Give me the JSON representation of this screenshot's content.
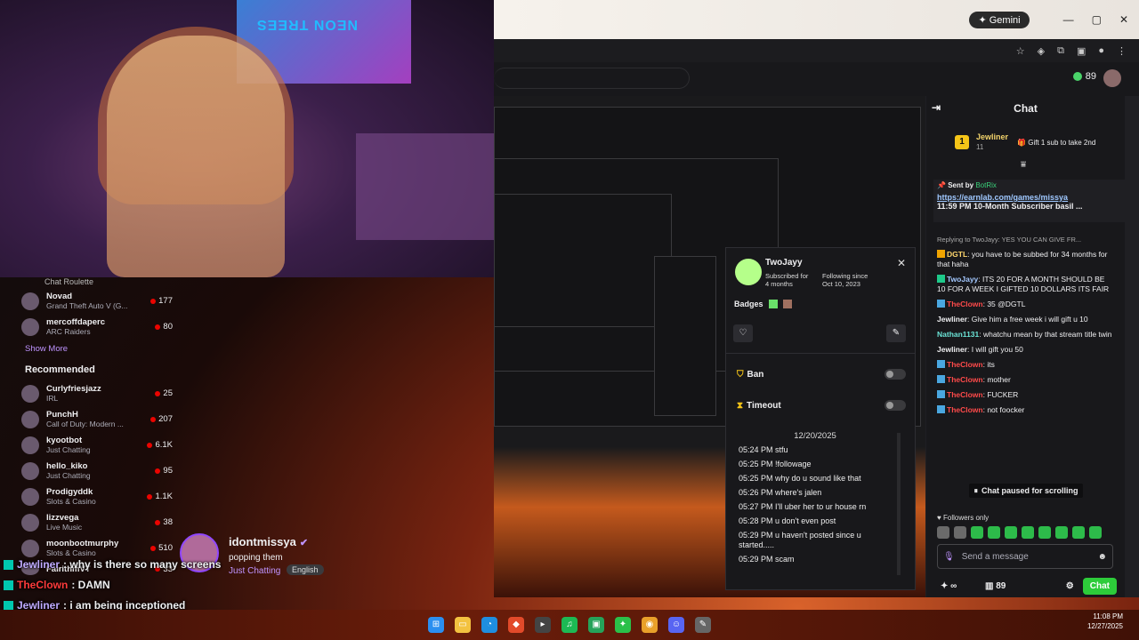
{
  "browser": {
    "gemini_label": "Gemini",
    "points": "89"
  },
  "sidebar": {
    "head": "Chat Roulette",
    "following": [
      {
        "name": "Novad",
        "game": "Grand Theft Auto V (G...",
        "viewers": "177"
      },
      {
        "name": "mercoffdaperc",
        "game": "ARC Raiders",
        "viewers": "80"
      }
    ],
    "show_more": "Show More",
    "recommended_title": "Recommended",
    "recommended": [
      {
        "name": "Curlyfriesjazz",
        "game": "IRL",
        "viewers": "25"
      },
      {
        "name": "PunchH",
        "game": "Call of Duty: Modern ...",
        "viewers": "207"
      },
      {
        "name": "kyootbot",
        "game": "Just Chatting",
        "viewers": "6.1K"
      },
      {
        "name": "hello_kiko",
        "game": "Just Chatting",
        "viewers": "95"
      },
      {
        "name": "Prodigyddk",
        "game": "Slots & Casino",
        "viewers": "1.1K"
      },
      {
        "name": "lizzvega",
        "game": "Live Music",
        "viewers": "38"
      },
      {
        "name": "moonbootmurphy",
        "game": "Slots & Casino",
        "viewers": "510"
      },
      {
        "name": "FairithmVT",
        "game": "",
        "viewers": "33"
      }
    ]
  },
  "channel": {
    "name": "idontmissya",
    "title": "popping them",
    "category": "Just Chatting",
    "language": "English"
  },
  "overlay_chat": [
    {
      "user": "Jewliner",
      "text": ": why is there so many screens",
      "color": "a"
    },
    {
      "user": "TheClown",
      "text": ": DAMN",
      "color": "b"
    },
    {
      "user": "Jewliner",
      "text": ": i am being inceptioned",
      "color": "a"
    }
  ],
  "usercard": {
    "name": "TwoJayy",
    "sub_label": "Subscribed for",
    "sub_value": "4 months",
    "follow_label": "Following since",
    "follow_value": "Oct 10, 2023",
    "badges_label": "Badges",
    "ban_label": "Ban",
    "timeout_label": "Timeout",
    "date": "12/20/2025",
    "messages": [
      "05:24 PM stfu",
      "05:25 PM !followage",
      "05:25 PM why do u sound like that",
      "05:26 PM where's jalen",
      "05:27 PM I'll uber her to ur house rn",
      "05:28 PM u don't even post",
      "05:29 PM u haven't posted since u started.....",
      "05:29 PM scam"
    ]
  },
  "chat": {
    "title": "Chat",
    "gift_user": "Jewliner",
    "gift_count": "11",
    "gift_cta": "Gift 1 sub to take 2nd",
    "pinned_sent": "Sent by",
    "pinned_bot": "BotRix",
    "pinned_link": "https://earnlab.com/games/missya",
    "pinned_msg": "11:59 PM 10-Month Subscriber basil ...",
    "lines": [
      {
        "user": "",
        "text": "Replying to TwoJayy: YES YOU CAN GIVE FR...",
        "cls": "reply"
      },
      {
        "user": "DGTL",
        "text": ": you have to be subbed for 34 months for that haha",
        "cls": "cu-gold"
      },
      {
        "user": "TwoJayy",
        "text": ": ITS 20 FOR A MONTH SHOULD BE 10 FOR A WEEK I GIFTED 10 DOLLARS ITS FAIR",
        "cls": "cu-blue"
      },
      {
        "user": "TheClown",
        "text": ": 35 @DGTL",
        "cls": "cu-red"
      },
      {
        "user": "Jewliner",
        "text": ": Give him a free week i will gift u 10",
        "cls": "cu"
      },
      {
        "user": "Nathan1131",
        "text": ": whatchu mean by that stream title twin",
        "cls": "cu-teal"
      },
      {
        "user": "Jewliner",
        "text": ": I will gift you 50",
        "cls": "cu"
      },
      {
        "user": "TheClown",
        "text": ": its",
        "cls": "cu-red"
      },
      {
        "user": "TheClown",
        "text": ": mother",
        "cls": "cu-red"
      },
      {
        "user": "TheClown",
        "text": ": FUCKER",
        "cls": "cu-red"
      },
      {
        "user": "TheClown",
        "text": ": not foocker",
        "cls": "cu-red"
      }
    ],
    "paused": "Chat paused for scrolling",
    "followers_only": "Followers only",
    "send_placeholder": "Send a message",
    "bits": "∞",
    "points": "89",
    "chat_button": "Chat"
  },
  "clock": {
    "time": "11:08 PM",
    "date": "12/27/2025"
  }
}
